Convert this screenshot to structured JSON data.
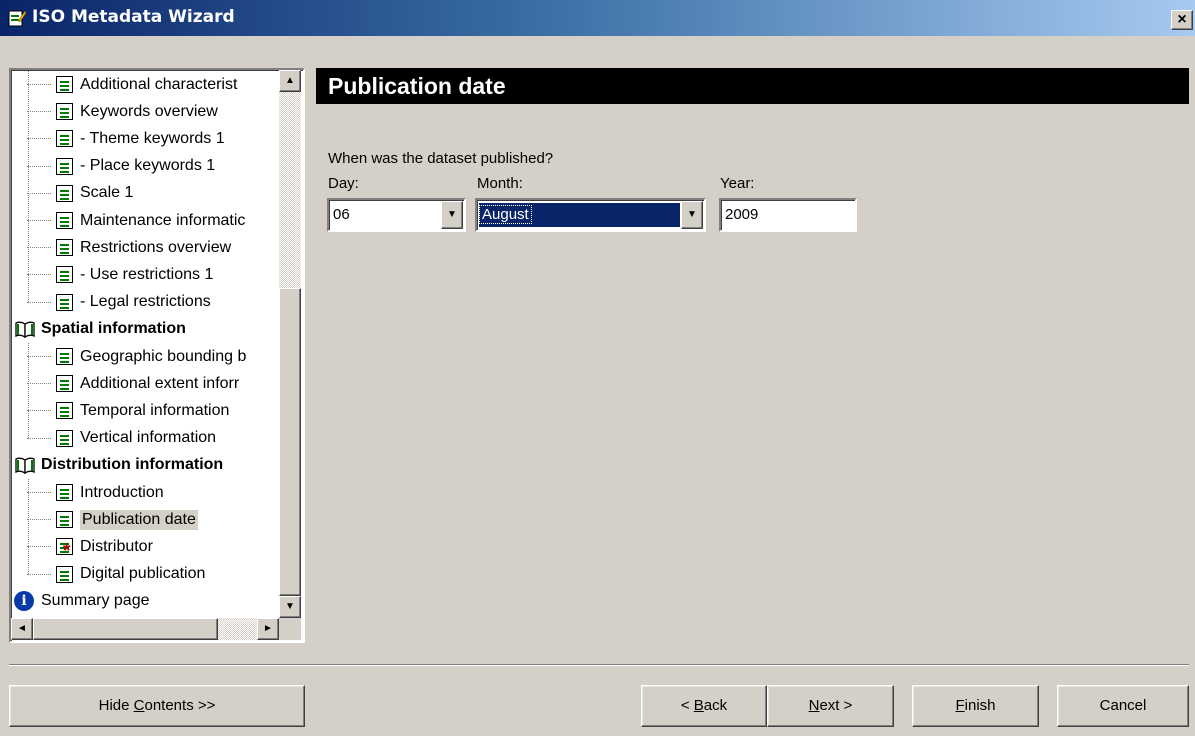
{
  "window": {
    "title": "ISO Metadata Wizard",
    "close_glyph": "×"
  },
  "tree": {
    "items": [
      {
        "label": "Additional characterist",
        "icon": "doc"
      },
      {
        "label": "Keywords overview",
        "icon": "doc"
      },
      {
        "label": "- Theme keywords 1",
        "icon": "doc"
      },
      {
        "label": "- Place keywords 1",
        "icon": "doc"
      },
      {
        "label": "Scale 1",
        "icon": "doc"
      },
      {
        "label": "Maintenance informatic",
        "icon": "doc"
      },
      {
        "label": "Restrictions overview",
        "icon": "doc"
      },
      {
        "label": "- Use restrictions 1",
        "icon": "doc"
      },
      {
        "label": "- Legal restrictions",
        "icon": "doc"
      },
      {
        "label": "Spatial information",
        "icon": "book"
      },
      {
        "label": "Geographic bounding b",
        "icon": "doc"
      },
      {
        "label": "Additional extent inforr",
        "icon": "doc"
      },
      {
        "label": "Temporal information",
        "icon": "doc"
      },
      {
        "label": "Vertical information",
        "icon": "doc"
      },
      {
        "label": "Distribution information",
        "icon": "book"
      },
      {
        "label": "Introduction",
        "icon": "doc"
      },
      {
        "label": "Publication date",
        "icon": "doc",
        "selected": true
      },
      {
        "label": "Distributor",
        "icon": "doc-required"
      },
      {
        "label": "Digital publication",
        "icon": "doc"
      },
      {
        "label": "Summary page",
        "icon": "info"
      }
    ],
    "scroll_up": "▲",
    "scroll_down": "▼",
    "scroll_left": "◄",
    "scroll_right": "►"
  },
  "page": {
    "title": "Publication date",
    "question": "When was the dataset published?",
    "day": {
      "label": "Day:",
      "value": "06",
      "arrow": "▼"
    },
    "month": {
      "label": "Month:",
      "value": "August",
      "arrow": "▼"
    },
    "year": {
      "label": "Year:",
      "value": "2009"
    }
  },
  "buttons": {
    "hide_contents": {
      "pre": "Hide ",
      "mnemonic": "C",
      "post": "ontents >>"
    },
    "back": {
      "pre": "< ",
      "mnemonic": "B",
      "post": "ack"
    },
    "next": {
      "pre": "",
      "mnemonic": "N",
      "post": "ext >"
    },
    "finish": {
      "pre": "",
      "mnemonic": "F",
      "post": "inish"
    },
    "cancel": {
      "pre": "",
      "mnemonic": "",
      "post": "Cancel"
    }
  },
  "colors": {
    "titlebar_start": "#0a246a",
    "titlebar_end": "#a6caf0",
    "face": "#d4d0c8",
    "selection": "#0a246a",
    "doc_icon_green": "#007a00",
    "required_star": "#b00000"
  }
}
